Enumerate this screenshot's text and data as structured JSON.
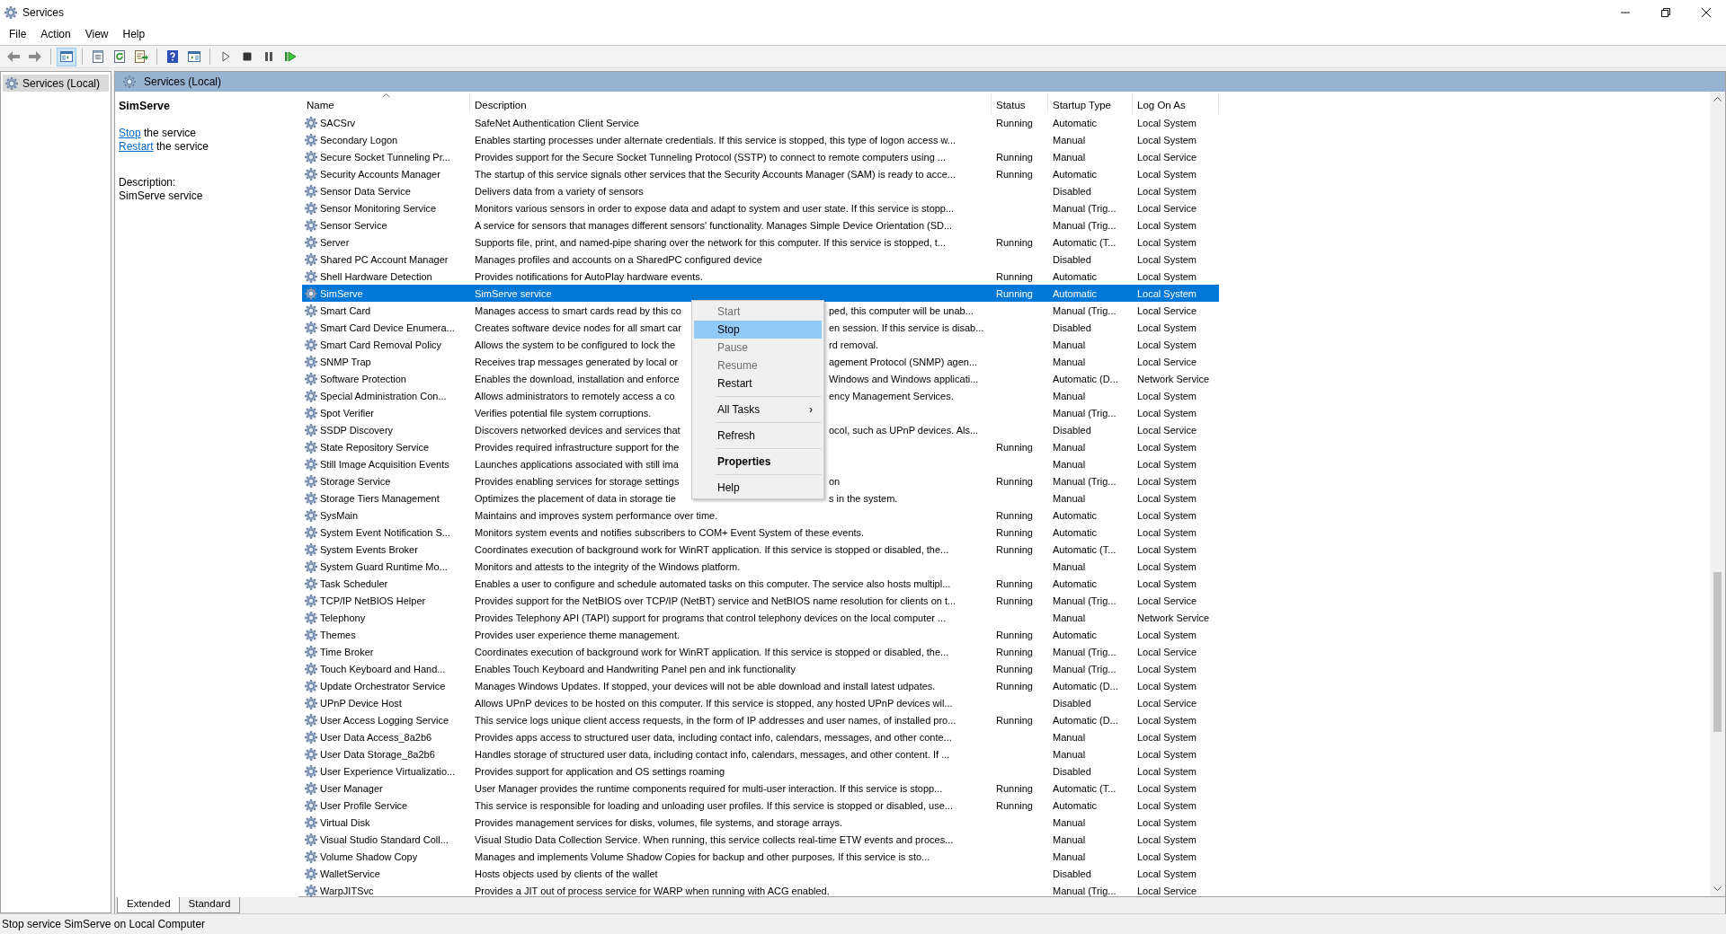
{
  "window": {
    "title": "Services"
  },
  "menu": [
    "File",
    "Action",
    "View",
    "Help"
  ],
  "toolbar": [
    {
      "kind": "back",
      "pressed": false
    },
    {
      "kind": "forward",
      "pressed": false
    },
    {
      "kind": "separator"
    },
    {
      "kind": "tree",
      "pressed": true
    },
    {
      "kind": "separator"
    },
    {
      "kind": "properties",
      "pressed": false
    },
    {
      "kind": "refresh",
      "pressed": false
    },
    {
      "kind": "export",
      "pressed": false
    },
    {
      "kind": "separator"
    },
    {
      "kind": "help",
      "pressed": false
    },
    {
      "kind": "pane",
      "pressed": false
    },
    {
      "kind": "separator"
    },
    {
      "kind": "play",
      "pressed": false
    },
    {
      "kind": "stop",
      "pressed": false
    },
    {
      "kind": "pause",
      "pressed": false
    },
    {
      "kind": "resume",
      "pressed": false
    }
  ],
  "tree": {
    "items": [
      {
        "label": "Services (Local)",
        "selected": true
      }
    ]
  },
  "panel": {
    "title": "Services (Local)"
  },
  "details": {
    "title": "SimServe",
    "actions": [
      {
        "link": "Stop",
        "rest": "the service"
      },
      {
        "link": "Restart",
        "rest": "the service"
      }
    ],
    "description_label": "Description:",
    "description": "SimServe service"
  },
  "table": {
    "columns": [
      {
        "label": "Name",
        "sorted": true
      },
      {
        "label": "Description",
        "sorted": false
      },
      {
        "label": "Status",
        "sorted": false
      },
      {
        "label": "Startup Type",
        "sorted": false
      },
      {
        "label": "Log On As",
        "sorted": false
      }
    ],
    "rows": [
      {
        "name": "SACSrv",
        "description": "SafeNet Authentication Client Service",
        "status": "Running",
        "startup": "Automatic",
        "logon": "Local System",
        "selected": false
      },
      {
        "name": "Secondary Logon",
        "description": "Enables starting processes under alternate credentials. If this service is stopped, this type of logon access w...",
        "startup": "Manual",
        "logon": "Local System",
        "selected": false
      },
      {
        "name": "Secure Socket Tunneling Pr...",
        "description": "Provides support for the Secure Socket Tunneling Protocol (SSTP) to connect to remote computers using ...",
        "status": "Running",
        "startup": "Manual",
        "logon": "Local Service",
        "selected": false
      },
      {
        "name": "Security Accounts Manager",
        "description": "The startup of this service signals other services that the Security Accounts Manager (SAM) is ready to acce...",
        "status": "Running",
        "startup": "Automatic",
        "logon": "Local System",
        "selected": false
      },
      {
        "name": "Sensor Data Service",
        "description": "Delivers data from a variety of sensors",
        "startup": "Disabled",
        "logon": "Local System",
        "selected": false
      },
      {
        "name": "Sensor Monitoring Service",
        "description": "Monitors various sensors in order to expose data and adapt to system and user state. If this service is stopp...",
        "startup": "Manual (Trig...",
        "logon": "Local Service",
        "selected": false
      },
      {
        "name": "Sensor Service",
        "description": "A service for sensors that manages different sensors' functionality. Manages Simple Device Orientation (SD...",
        "startup": "Manual (Trig...",
        "logon": "Local System",
        "selected": false
      },
      {
        "name": "Server",
        "description": "Supports file, print, and named-pipe sharing over the network for this computer. If this service is stopped, t...",
        "status": "Running",
        "startup": "Automatic (T...",
        "logon": "Local System",
        "selected": false
      },
      {
        "name": "Shared PC Account Manager",
        "description": "Manages profiles and accounts on a SharedPC configured device",
        "startup": "Disabled",
        "logon": "Local System",
        "selected": false
      },
      {
        "name": "Shell Hardware Detection",
        "description": "Provides notifications for AutoPlay hardware events.",
        "status": "Running",
        "startup": "Automatic",
        "logon": "Local System",
        "selected": false
      },
      {
        "name": "SimServe",
        "description": "SimServe service",
        "status": "Running",
        "startup": "Automatic",
        "logon": "Local System",
        "selected": true
      },
      {
        "name": "Smart Card",
        "description": "Manages access to smart cards read by this co",
        "description_tail": "ped, this computer will be unab...",
        "startup": "Manual (Trig...",
        "logon": "Local Service",
        "selected": false
      },
      {
        "name": "Smart Card Device Enumera...",
        "description": "Creates software device nodes for all smart car",
        "description_tail": "en session. If this service is disab...",
        "startup": "Disabled",
        "logon": "Local System",
        "selected": false
      },
      {
        "name": "Smart Card Removal Policy",
        "description": "Allows the system to be configured to lock the",
        "description_tail": "rd removal.",
        "startup": "Manual",
        "logon": "Local System",
        "selected": false
      },
      {
        "name": "SNMP Trap",
        "description": "Receives trap messages generated by local or",
        "description_tail": "agement Protocol (SNMP) agen...",
        "startup": "Manual",
        "logon": "Local Service",
        "selected": false
      },
      {
        "name": "Software Protection",
        "description": "Enables the download, installation and enforce",
        "description_tail": "Windows and Windows applicati...",
        "startup": "Automatic (D...",
        "logon": "Network Service",
        "selected": false
      },
      {
        "name": "Special Administration Con...",
        "description": "Allows administrators to remotely access a co",
        "description_tail": "ency Management Services.",
        "startup": "Manual",
        "logon": "Local System",
        "selected": false
      },
      {
        "name": "Spot Verifier",
        "description": "Verifies potential file system corruptions.",
        "startup": "Manual (Trig...",
        "logon": "Local System",
        "selected": false
      },
      {
        "name": "SSDP Discovery",
        "description": "Discovers networked devices and services that",
        "description_tail": "ocol, such as UPnP devices. Als...",
        "startup": "Disabled",
        "logon": "Local Service",
        "selected": false
      },
      {
        "name": "State Repository Service",
        "description": "Provides required infrastructure support for the",
        "status": "Running",
        "startup": "Manual",
        "logon": "Local System",
        "selected": false
      },
      {
        "name": "Still Image Acquisition Events",
        "description": "Launches applications associated with still ima",
        "startup": "Manual",
        "logon": "Local System",
        "selected": false
      },
      {
        "name": "Storage Service",
        "description": "Provides enabling services for storage settings",
        "description_tail": "on",
        "status": "Running",
        "startup": "Manual (Trig...",
        "logon": "Local System",
        "selected": false
      },
      {
        "name": "Storage Tiers Management",
        "description": "Optimizes the placement of data in storage tie",
        "description_tail": "s in the system.",
        "startup": "Manual",
        "logon": "Local System",
        "selected": false
      },
      {
        "name": "SysMain",
        "description": "Maintains and improves system performance over time.",
        "status": "Running",
        "startup": "Automatic",
        "logon": "Local System",
        "selected": false
      },
      {
        "name": "System Event Notification S...",
        "description": "Monitors system events and notifies subscribers to COM+ Event System of these events.",
        "status": "Running",
        "startup": "Automatic",
        "logon": "Local System",
        "selected": false
      },
      {
        "name": "System Events Broker",
        "description": "Coordinates execution of background work for WinRT application. If this service is stopped or disabled, the...",
        "status": "Running",
        "startup": "Automatic (T...",
        "logon": "Local System",
        "selected": false
      },
      {
        "name": "System Guard Runtime Mo...",
        "description": "Monitors and attests to the integrity of the Windows platform.",
        "startup": "Manual",
        "logon": "Local System",
        "selected": false
      },
      {
        "name": "Task Scheduler",
        "description": "Enables a user to configure and schedule automated tasks on this computer. The service also hosts multipl...",
        "status": "Running",
        "startup": "Automatic",
        "logon": "Local System",
        "selected": false
      },
      {
        "name": "TCP/IP NetBIOS Helper",
        "description": "Provides support for the NetBIOS over TCP/IP (NetBT) service and NetBIOS name resolution for clients on t...",
        "status": "Running",
        "startup": "Manual (Trig...",
        "logon": "Local Service",
        "selected": false
      },
      {
        "name": "Telephony",
        "description": "Provides Telephony API (TAPI) support for programs that control telephony devices on the local computer ...",
        "startup": "Manual",
        "logon": "Network Service",
        "selected": false
      },
      {
        "name": "Themes",
        "description": "Provides user experience theme management.",
        "status": "Running",
        "startup": "Automatic",
        "logon": "Local System",
        "selected": false
      },
      {
        "name": "Time Broker",
        "description": "Coordinates execution of background work for WinRT application. If this service is stopped or disabled, the...",
        "status": "Running",
        "startup": "Manual (Trig...",
        "logon": "Local Service",
        "selected": false
      },
      {
        "name": "Touch Keyboard and Hand...",
        "description": "Enables Touch Keyboard and Handwriting Panel pen and ink functionality",
        "status": "Running",
        "startup": "Manual (Trig...",
        "logon": "Local System",
        "selected": false
      },
      {
        "name": "Update Orchestrator Service",
        "description": "Manages Windows Updates. If stopped, your devices will not be able download and install latest udpates.",
        "status": "Running",
        "startup": "Automatic (D...",
        "logon": "Local System",
        "selected": false
      },
      {
        "name": "UPnP Device Host",
        "description": "Allows UPnP devices to be hosted on this computer. If this service is stopped, any hosted UPnP devices wil...",
        "startup": "Disabled",
        "logon": "Local Service",
        "selected": false
      },
      {
        "name": "User Access Logging Service",
        "description": "This service logs unique client access requests, in the form of IP addresses and user names, of installed pro...",
        "status": "Running",
        "startup": "Automatic (D...",
        "logon": "Local System",
        "selected": false
      },
      {
        "name": "User Data Access_8a2b6",
        "description": "Provides apps access to structured user data, including contact info, calendars, messages, and other conte...",
        "startup": "Manual",
        "logon": "Local System",
        "selected": false
      },
      {
        "name": "User Data Storage_8a2b6",
        "description": "Handles storage of structured user data, including contact info, calendars, messages, and other content. If ...",
        "startup": "Manual",
        "logon": "Local System",
        "selected": false
      },
      {
        "name": "User Experience Virtualizatio...",
        "description": "Provides support for application and OS settings roaming",
        "startup": "Disabled",
        "logon": "Local System",
        "selected": false
      },
      {
        "name": "User Manager",
        "description": "User Manager provides the runtime components required for multi-user interaction. If this service is stopp...",
        "status": "Running",
        "startup": "Automatic (T...",
        "logon": "Local System",
        "selected": false
      },
      {
        "name": "User Profile Service",
        "description": "This service is responsible for loading and unloading user profiles. If this service is stopped or disabled, use...",
        "status": "Running",
        "startup": "Automatic",
        "logon": "Local System",
        "selected": false
      },
      {
        "name": "Virtual Disk",
        "description": "Provides management services for disks, volumes, file systems, and storage arrays.",
        "startup": "Manual",
        "logon": "Local System",
        "selected": false
      },
      {
        "name": "Visual Studio Standard Coll...",
        "description": "Visual Studio Data Collection Service. When running, this service collects real-time ETW events and proces...",
        "startup": "Manual",
        "logon": "Local System",
        "selected": false
      },
      {
        "name": "Volume Shadow Copy",
        "description": "Manages and implements Volume Shadow Copies for backup and other purposes. If this service is sto...",
        "startup": "Manual",
        "logon": "Local System",
        "selected": false
      },
      {
        "name": "WalletService",
        "description": "Hosts objects used by clients of the wallet",
        "startup": "Disabled",
        "logon": "Local System",
        "selected": false
      },
      {
        "name": "WarpJITSvc",
        "description": "Provides a JIT out of process service for WARP when running with ACG enabled.",
        "startup": "Manual (Trig...",
        "logon": "Local Service",
        "selected": false
      }
    ]
  },
  "context_menu": {
    "items": [
      {
        "kind": "item",
        "label": "Start",
        "disabled": true,
        "selected": false
      },
      {
        "kind": "item",
        "label": "Stop",
        "disabled": false,
        "selected": true
      },
      {
        "kind": "item",
        "label": "Pause",
        "disabled": true,
        "selected": false
      },
      {
        "kind": "item",
        "label": "Resume",
        "disabled": true,
        "selected": false
      },
      {
        "kind": "item",
        "label": "Restart",
        "disabled": false,
        "selected": false
      },
      {
        "kind": "separator"
      },
      {
        "kind": "submenu",
        "label": "All Tasks",
        "submenu_arrow": "›",
        "disabled": false,
        "selected": false
      },
      {
        "kind": "separator"
      },
      {
        "kind": "item",
        "label": "Refresh",
        "disabled": false,
        "selected": false
      },
      {
        "kind": "separator"
      },
      {
        "kind": "default",
        "label": "Properties",
        "disabled": false,
        "selected": false
      },
      {
        "kind": "separator"
      },
      {
        "kind": "item",
        "label": "Help",
        "disabled": false,
        "selected": false
      }
    ]
  },
  "view_tabs": [
    {
      "label": "Extended",
      "selected": true
    },
    {
      "label": "Standard",
      "selected": false
    }
  ],
  "status_bar": "Stop service SimServe on Local Computer"
}
